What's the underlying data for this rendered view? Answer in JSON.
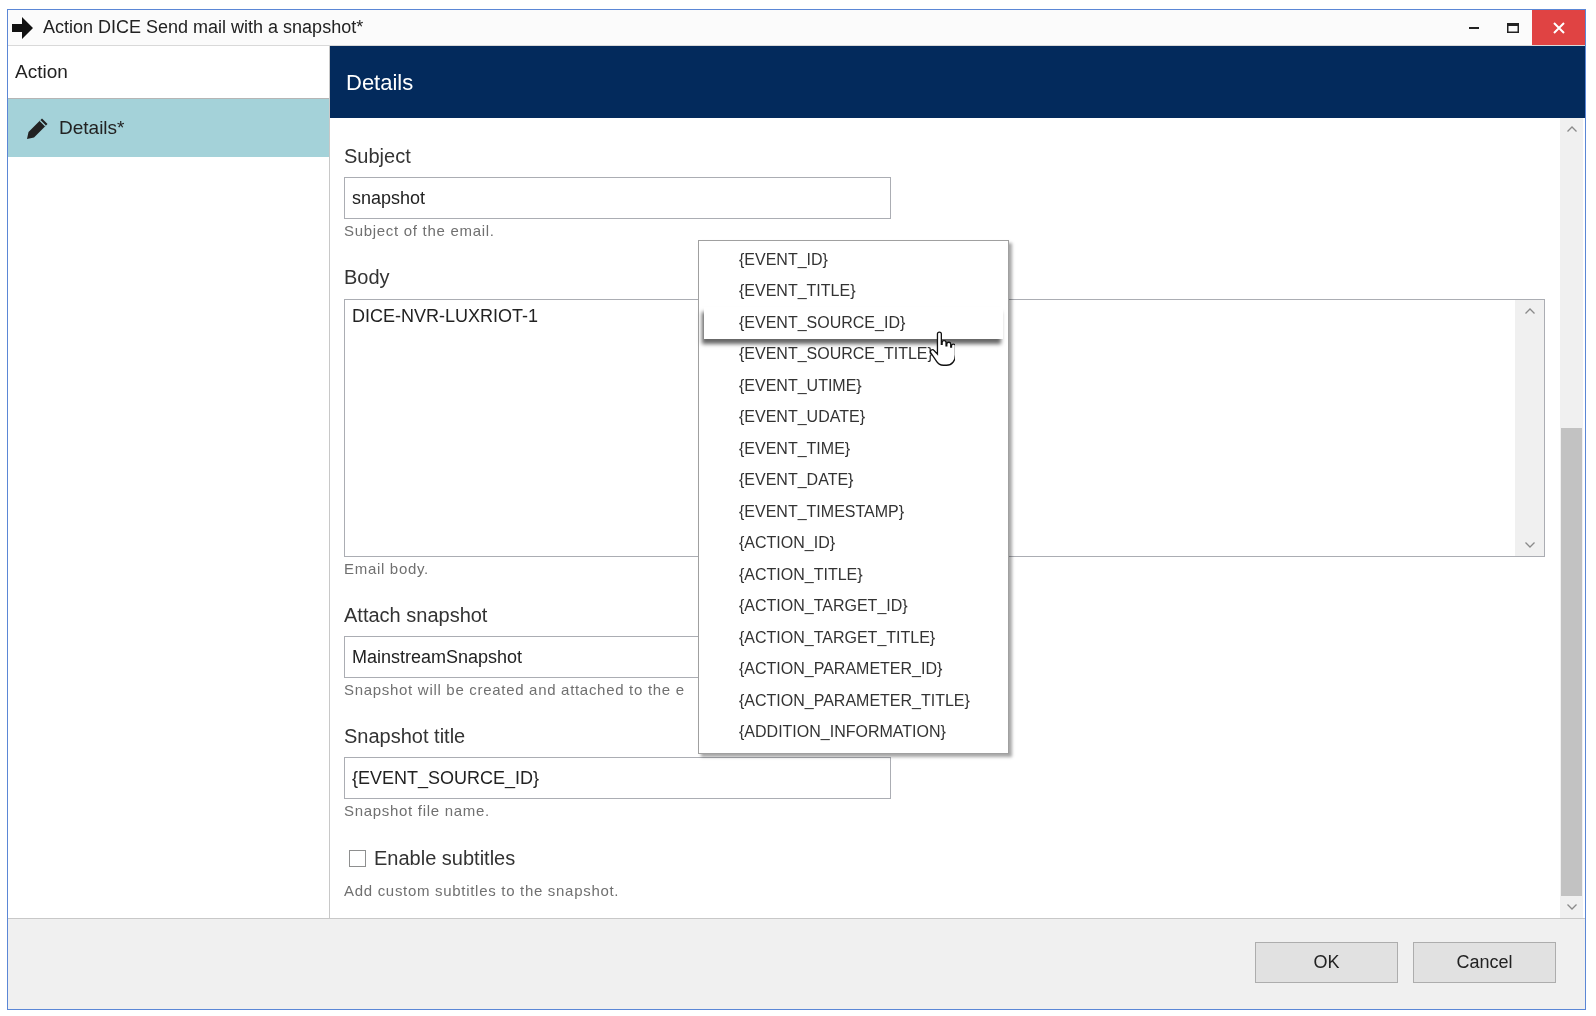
{
  "window": {
    "title": "Action DICE Send mail with a snapshot*"
  },
  "sidebar": {
    "header": "Action",
    "items": [
      {
        "label": "Details*",
        "selected": true
      }
    ]
  },
  "panel": {
    "title": "Details"
  },
  "fields": [
    {
      "kind": "text",
      "label": "Subject",
      "value": "snapshot",
      "help": "Subject of the email."
    },
    {
      "kind": "textarea",
      "label": "Body",
      "value": "DICE-NVR-LUXRIOT-1",
      "help": "Email body."
    },
    {
      "kind": "text",
      "label": "Attach snapshot",
      "value": "MainstreamSnapshot",
      "help": "Snapshot will be created and attached to the e"
    },
    {
      "kind": "text",
      "label": "Snapshot title",
      "value": "{EVENT_SOURCE_ID}",
      "help": "Snapshot file name."
    },
    {
      "kind": "checkbox",
      "label": "Enable subtitles",
      "checked": false,
      "help": "Add custom subtitles to the snapshot."
    }
  ],
  "menu": {
    "items": [
      {
        "label": "{EVENT_ID}",
        "hovered": false
      },
      {
        "label": "{EVENT_TITLE}",
        "hovered": false
      },
      {
        "label": "{EVENT_SOURCE_ID}",
        "hovered": true
      },
      {
        "label": "{EVENT_SOURCE_TITLE}",
        "hovered": false
      },
      {
        "label": "{EVENT_UTIME}",
        "hovered": false
      },
      {
        "label": "{EVENT_UDATE}",
        "hovered": false
      },
      {
        "label": "{EVENT_TIME}",
        "hovered": false
      },
      {
        "label": "{EVENT_DATE}",
        "hovered": false
      },
      {
        "label": "{EVENT_TIMESTAMP}",
        "hovered": false
      },
      {
        "label": "{ACTION_ID}",
        "hovered": false
      },
      {
        "label": "{ACTION_TITLE}",
        "hovered": false
      },
      {
        "label": "{ACTION_TARGET_ID}",
        "hovered": false
      },
      {
        "label": "{ACTION_TARGET_TITLE}",
        "hovered": false
      },
      {
        "label": "{ACTION_PARAMETER_ID}",
        "hovered": false
      },
      {
        "label": "{ACTION_PARAMETER_TITLE}",
        "hovered": false
      },
      {
        "label": "{ADDITION_INFORMATION}",
        "hovered": false
      }
    ]
  },
  "buttons": [
    {
      "label": "OK"
    },
    {
      "label": "Cancel"
    }
  ]
}
